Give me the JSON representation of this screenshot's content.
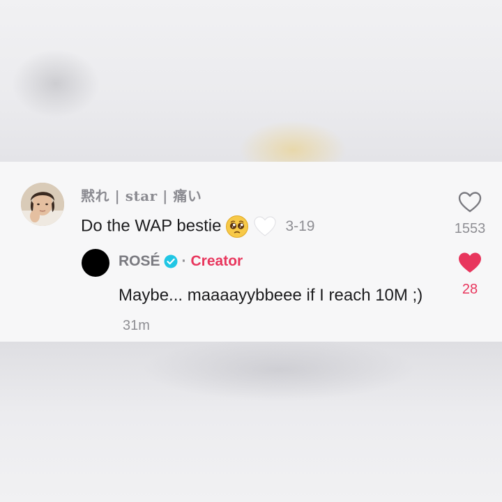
{
  "comment": {
    "username": "黙れ | star | 痛い",
    "text": "Do the WAP bestie",
    "emojis": [
      "pleading-face-emoji",
      "white-heart-emoji"
    ],
    "timestamp": "3-19",
    "like_count": "1553",
    "liked": false
  },
  "reply": {
    "username": "ROSÉ",
    "verified": true,
    "separator": "·",
    "badge": "Creator",
    "text": "Maybe... maaaayybbeee if I reach 10M ;)",
    "timestamp": "31m",
    "like_count": "28",
    "liked": true
  },
  "colors": {
    "accent_red": "#e8365d",
    "verified_blue": "#20c6e4",
    "muted_text": "#8e8e93",
    "primary_text": "#1c1c1e"
  }
}
